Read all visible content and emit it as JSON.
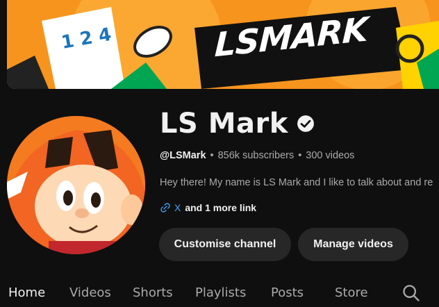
{
  "banner": {
    "wordmark": "LSMARK"
  },
  "channel": {
    "name": "LS Mark",
    "handle": "@LSMark",
    "subscribers": "856k subscribers",
    "videos": "300 videos",
    "description": "Hey there! My name is LS Mark and I like to talk about and re",
    "links": {
      "primary": "X",
      "more": "and 1 more link"
    }
  },
  "buttons": {
    "customise": "Customise channel",
    "manage": "Manage videos"
  },
  "tabs": [
    "Home",
    "Videos",
    "Shorts",
    "Playlists",
    "Posts",
    "Store"
  ],
  "colors": {
    "background": "#0f0f0f",
    "button_bg": "#272727",
    "link": "#3ea6ff",
    "banner_orange": "#f7941d"
  },
  "icons": {
    "verified": "verified-check-icon",
    "link": "link-icon",
    "search": "search-icon"
  }
}
